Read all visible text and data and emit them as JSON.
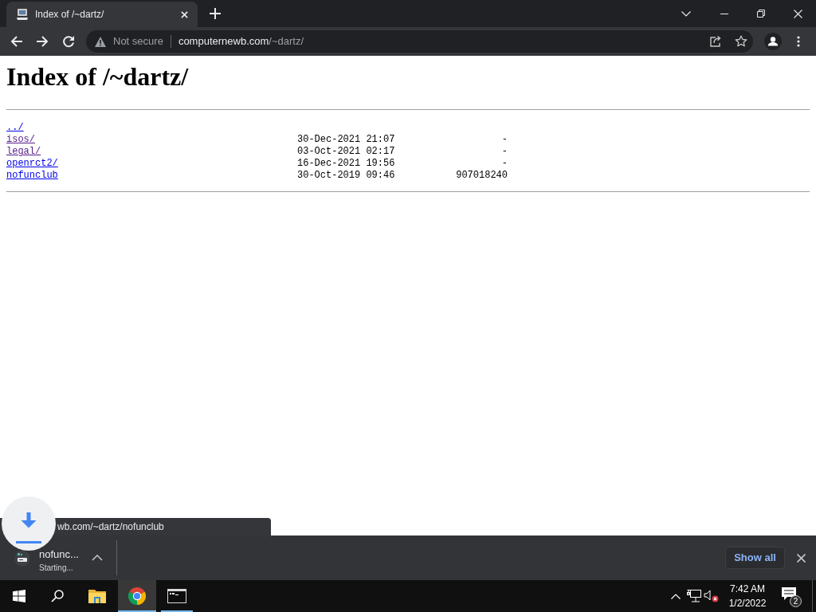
{
  "browser": {
    "tabs": [
      {
        "title": "Index of /~dartz/",
        "selected": true
      }
    ],
    "omnibox": {
      "security_label": "Not secure",
      "host": "computernewb.com",
      "path": "/~dartz/"
    }
  },
  "page": {
    "heading": "Index of /~dartz/",
    "entries": [
      {
        "name": "../",
        "visited": false
      },
      {
        "name": "isos/",
        "modified": "30-Dec-2021 21:07",
        "size": "-",
        "visited": true
      },
      {
        "name": "legal/",
        "modified": "03-Oct-2021 02:17",
        "size": "-",
        "visited": true
      },
      {
        "name": "openrct2/",
        "modified": "16-Dec-2021 19:56",
        "size": "-",
        "visited": false
      },
      {
        "name": "nofunclub",
        "modified": "30-Oct-2019 09:46",
        "size": "907018240",
        "visited": false
      }
    ]
  },
  "status_bubble": {
    "url": "wb.com/~dartz/nofunclub"
  },
  "download_shelf": {
    "items": [
      {
        "name": "nofunc...",
        "status": "Starting..."
      }
    ],
    "show_all": "Show all"
  },
  "taskbar": {
    "apps": [
      {
        "kind": "folder",
        "running": false,
        "active": false
      },
      {
        "kind": "browser",
        "running": true,
        "active": true
      },
      {
        "kind": "terminal",
        "running": true,
        "active": false
      }
    ],
    "tray": {
      "volume_muted": true
    },
    "clock": {
      "time": "7:42 AM",
      "date": "1/2/2022"
    },
    "notifications": {
      "count": "2"
    }
  }
}
